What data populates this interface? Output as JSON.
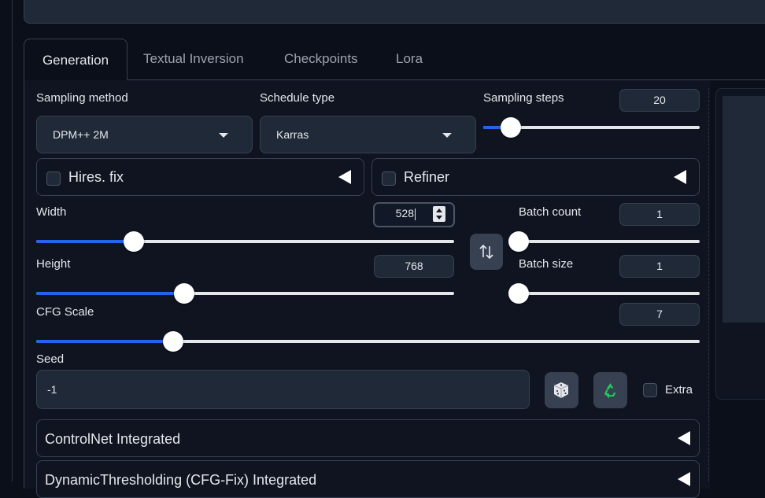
{
  "tabs": [
    {
      "label": "Generation",
      "active": true
    },
    {
      "label": "Textual Inversion",
      "active": false
    },
    {
      "label": "Checkpoints",
      "active": false
    },
    {
      "label": "Lora",
      "active": false
    }
  ],
  "sampling_method": {
    "label": "Sampling method",
    "value": "DPM++ 2M"
  },
  "schedule_type": {
    "label": "Schedule type",
    "value": "Karras"
  },
  "sampling_steps": {
    "label": "Sampling steps",
    "value": "20",
    "min": 1,
    "max": 150
  },
  "hires_fix": {
    "label": "Hires. fix",
    "checked": false
  },
  "refiner": {
    "label": "Refiner",
    "checked": false
  },
  "width": {
    "label": "Width",
    "value": "528",
    "min": 64,
    "max": 2048
  },
  "height": {
    "label": "Height",
    "value": "768",
    "min": 64,
    "max": 2048
  },
  "swap_icon": "swap-vertical-icon",
  "batch_count": {
    "label": "Batch count",
    "value": "1",
    "min": 1,
    "max": 100
  },
  "batch_size": {
    "label": "Batch size",
    "value": "1",
    "min": 1,
    "max": 8
  },
  "cfg_scale": {
    "label": "CFG Scale",
    "value": "7",
    "min": 1,
    "max": 30
  },
  "seed": {
    "label": "Seed",
    "value": "-1",
    "dice_icon": "dice-icon",
    "recycle_icon": "recycle-icon",
    "extra_label": "Extra",
    "extra_checked": false
  },
  "accordions": [
    {
      "label": "ControlNet Integrated"
    },
    {
      "label": "DynamicThresholding (CFG-Fix) Integrated"
    }
  ],
  "colors": {
    "accent": "#2563eb",
    "background": "#0b0f19",
    "panel": "#1f2937",
    "border": "#374151",
    "recycle": "#22c55e"
  }
}
